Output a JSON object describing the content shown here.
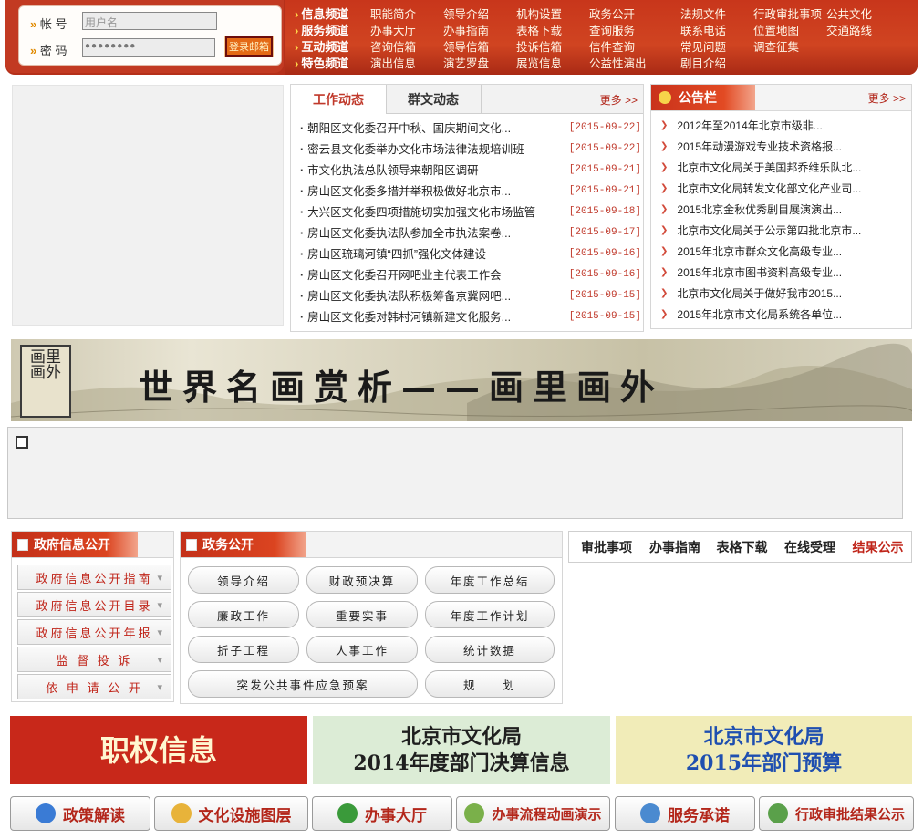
{
  "login": {
    "account_label": "帐 号",
    "password_label": "密 码",
    "username_placeholder": "用户名",
    "password_value": "●●●●●●●●",
    "login_button": "登录邮箱"
  },
  "nav": {
    "rows": [
      {
        "channel": "信息频道",
        "items": [
          "职能简介",
          "领导介绍",
          "机构设置",
          "政务公开",
          "法规文件",
          "行政审批事项",
          "公共文化"
        ]
      },
      {
        "channel": "服务频道",
        "items": [
          "办事大厅",
          "办事指南",
          "表格下载",
          "查询服务",
          "联系电话",
          "位置地图",
          "交通路线"
        ]
      },
      {
        "channel": "互动频道",
        "items": [
          "咨询信箱",
          "领导信箱",
          "投诉信箱",
          "信件查询",
          "常见问题",
          "调查征集",
          ""
        ]
      },
      {
        "channel": "特色频道",
        "items": [
          "演出信息",
          "演艺罗盘",
          "展览信息",
          "公益性演出",
          "剧目介绍",
          "",
          ""
        ]
      }
    ]
  },
  "news": {
    "tab_active": "工作动态",
    "tab_inactive": "群文动态",
    "more": "更多 >>",
    "items": [
      {
        "title": "朝阳区文化委召开中秋、国庆期间文化...",
        "date": "[2015-09-22]"
      },
      {
        "title": "密云县文化委举办文化市场法律法规培训班",
        "date": "[2015-09-22]"
      },
      {
        "title": "市文化执法总队领导来朝阳区调研",
        "date": "[2015-09-21]"
      },
      {
        "title": "房山区文化委多措并举积极做好北京市...",
        "date": "[2015-09-21]"
      },
      {
        "title": "大兴区文化委四项措施切实加强文化市场监管",
        "date": "[2015-09-18]"
      },
      {
        "title": "房山区文化委执法队参加全市执法案卷...",
        "date": "[2015-09-17]"
      },
      {
        "title": "房山区琉璃河镇“四抓”强化文体建设",
        "date": "[2015-09-16]"
      },
      {
        "title": "房山区文化委召开网吧业主代表工作会",
        "date": "[2015-09-16]"
      },
      {
        "title": "房山区文化委执法队积极筹备京冀网吧...",
        "date": "[2015-09-15]"
      },
      {
        "title": "房山区文化委对韩村河镇新建文化服务...",
        "date": "[2015-09-15]"
      }
    ]
  },
  "notice": {
    "title": "公告栏",
    "more": "更多 >>",
    "items": [
      "2012年至2014年北京市级非...",
      "2015年动漫游戏专业技术资格报...",
      "北京市文化局关于美国邦乔维乐队北...",
      "北京市文化局转发文化部文化产业司...",
      "2015北京金秋优秀剧目展演演出...",
      "北京市文化局关于公示第四批北京市...",
      "2015年北京市群众文化高级专业...",
      "2015年北京市图书资料高级专业...",
      "北京市文化局关于做好我市2015...",
      "2015年北京市文化局系统各单位..."
    ]
  },
  "banner": {
    "seal": "画里画外",
    "text": "世界名画赏析——画里画外"
  },
  "gov_info": {
    "title": "政府信息公开",
    "items": [
      "政府信息公开指南",
      "政府信息公开目录",
      "政府信息公开年报",
      "监 督 投 诉",
      "依 申 请 公 开"
    ]
  },
  "zhengwu": {
    "title": "政务公开",
    "items": [
      "领导介绍",
      "财政预决算",
      "年度工作总结",
      "廉政工作",
      "重要实事",
      "年度工作计划",
      "折子工程",
      "人事工作",
      "统计数据",
      "突发公共事件应急预案",
      "规　　划"
    ]
  },
  "approval": {
    "tabs": [
      "审批事项",
      "办事指南",
      "表格下载",
      "在线受理",
      "结果公示"
    ]
  },
  "promos": [
    {
      "text": "职权信息",
      "bg": "#c8281a",
      "color": "#fff6d0"
    },
    {
      "text": "北京市文化局\n2014年度部门决算信息",
      "bg": "#dcecd6",
      "color": "#1f1f1f"
    },
    {
      "text": "北京市文化局\n2015年部门预算",
      "bg": "#f1ecb8",
      "color": "#1f4fb0"
    }
  ],
  "bottom_buttons": [
    {
      "label": "政策解读",
      "icon": "globe-icon",
      "color": "#3a7bd5"
    },
    {
      "label": "文化设施图层",
      "icon": "chart-icon",
      "color": "#e8b33a"
    },
    {
      "label": "办事大厅",
      "icon": "house-icon",
      "color": "#3a9a3a"
    },
    {
      "label": "办事流程动画演示",
      "icon": "flow-icon",
      "color": "#7ab04a"
    },
    {
      "label": "服务承诺",
      "icon": "people-icon",
      "color": "#4a8ad0"
    },
    {
      "label": "行政审批结果公示",
      "icon": "document-icon",
      "color": "#5aa04a"
    }
  ],
  "colors": {
    "brand_red": "#c0392b",
    "nav_bg": "#c8361b",
    "date_red": "#c0392b"
  }
}
